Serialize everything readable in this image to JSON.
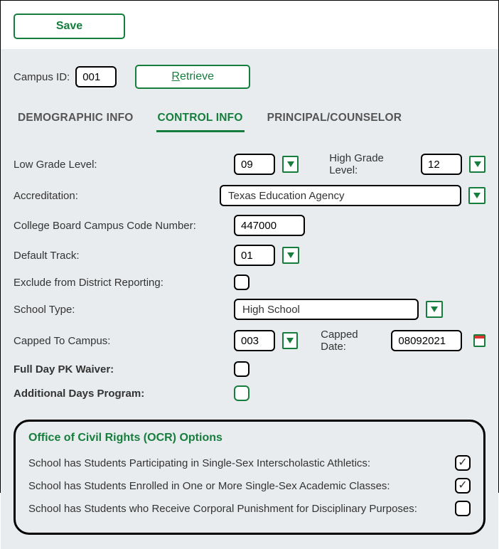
{
  "toolbar": {
    "save_label": "Save",
    "retrieve_label": "Retrieve",
    "retrieve_ul": "R",
    "retrieve_rest": "etrieve"
  },
  "campus": {
    "label": "Campus ID:",
    "value": "001"
  },
  "tabs": [
    {
      "label": "DEMOGRAPHIC INFO",
      "active": false
    },
    {
      "label": "CONTROL INFO",
      "active": true
    },
    {
      "label": "PRINCIPAL/COUNSELOR",
      "active": false
    }
  ],
  "fields": {
    "low_grade": {
      "label": "Low Grade Level:",
      "value": "09"
    },
    "high_grade": {
      "label": "High Grade Level:",
      "value": "12"
    },
    "accreditation": {
      "label": "Accreditation:",
      "value": "Texas Education Agency"
    },
    "cb_code": {
      "label": "College Board Campus Code Number:",
      "value": "447000"
    },
    "default_track": {
      "label": "Default Track:",
      "value": "01"
    },
    "exclude": {
      "label": "Exclude from District Reporting:",
      "checked": false
    },
    "school_type": {
      "label": "School Type:",
      "value": "High School"
    },
    "capped_to": {
      "label": "Capped To Campus:",
      "value": "003"
    },
    "capped_date": {
      "label": "Capped Date:",
      "value": "08092021"
    },
    "full_day_pk": {
      "label": "Full Day PK Waiver:",
      "checked": false
    },
    "add_days": {
      "label": "Additional Days Program:",
      "checked": false
    }
  },
  "ocr": {
    "title": "Office of Civil Rights (OCR) Options",
    "rows": [
      {
        "label": "School has Students Participating in Single-Sex Interscholastic Athletics:",
        "checked": true
      },
      {
        "label": "School has Students Enrolled in One or More Single-Sex Academic Classes:",
        "checked": true
      },
      {
        "label": "School has Students who Receive Corporal Punishment for Disciplinary Purposes:",
        "checked": false
      }
    ]
  }
}
